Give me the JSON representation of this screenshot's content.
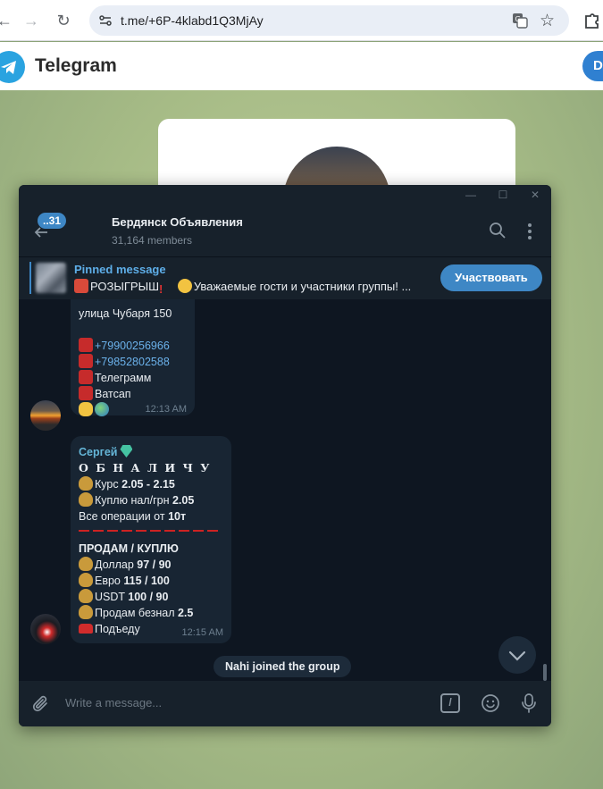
{
  "browser": {
    "url": "t.me/+6P-4klabd1Q3MjAy"
  },
  "tg_web": {
    "brand": "Telegram",
    "download_label": "D"
  },
  "chat": {
    "unread_badge": "..31",
    "name": "Бердянск Объявления",
    "members": "31,164 members"
  },
  "pinned": {
    "title": "Pinned message",
    "text": "РОЗЫГРЫШ",
    "text2": "Уважаемые гости и участники группы! ...",
    "button_label": "Участвовать"
  },
  "message1": {
    "lines": [
      "улица Чубаря 150",
      "+79900256966",
      "+79852802588",
      "Телеграмм",
      "Ватсап"
    ],
    "time": "12:13 AM"
  },
  "message2": {
    "sender": "Сергей",
    "headline": "О Б Н А Л И Ч У",
    "rate_label": "Курс ",
    "rate_value": "2.05 - 2.15",
    "buy_label": "Куплю нал/грн ",
    "buy_value": "2.05",
    "ops_label": "Все операции от ",
    "ops_value": "10т",
    "section": "ПРОДАМ / КУПЛЮ",
    "items": [
      {
        "label": "Доллар ",
        "value": "97 / 90"
      },
      {
        "label": "Евро ",
        "value": "115 / 100"
      },
      {
        "label": "USDT ",
        "value": "100 / 90"
      },
      {
        "label": "Продам безнал ",
        "value": "2.5"
      }
    ],
    "last_line": "Подъеду",
    "time": "12:15 AM"
  },
  "system_message": "Nahi joined the group",
  "composer": {
    "placeholder": "Write a message..."
  },
  "colors": {
    "accent": "#3e87c5",
    "window_bg": "#0e1621",
    "bubble_bg": "#182533",
    "link": "#6bb1ea"
  }
}
